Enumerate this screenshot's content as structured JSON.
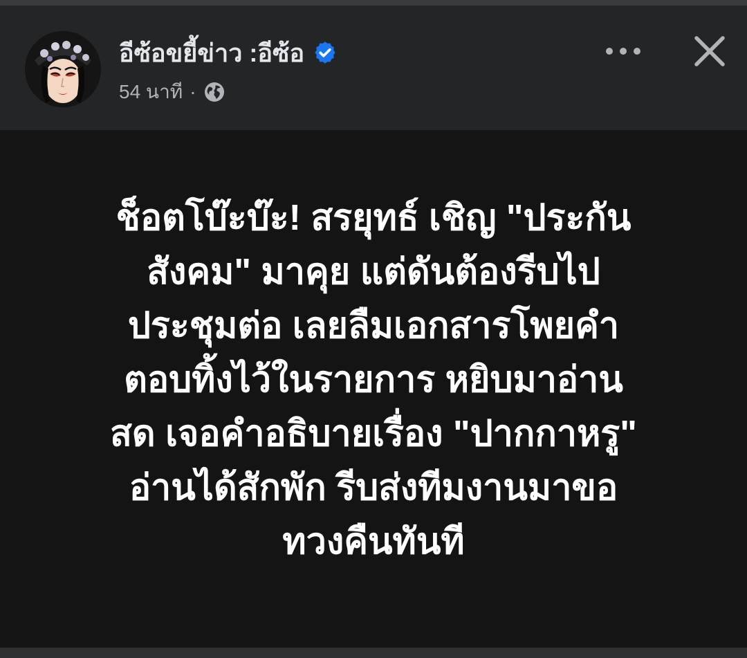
{
  "post": {
    "author": "อีซ้อขยี้ข่าว :อีซ้อ",
    "verified": true,
    "time": "54 นาที",
    "separator": "·",
    "privacy_icon": "globe-icon",
    "text_lines": [
      "ช็อตโบ๊ะบ๊ะ! สรยุทธ์ เชิญ \"ประกัน",
      "สังคม\" มาคุย แต่ดันต้องรีบไป",
      "ประชุมต่อ เลยลืมเอกสารโพยคำ",
      "ตอบทิ้งไว้ในรายการ หยิบมาอ่าน",
      "สด เจอคำอธิบายเรื่อง \"ปากกาหรู\"",
      "อ่านได้สักพัก รีบส่งทีมงานมาขอ",
      "ทวงคืนทันที"
    ]
  },
  "icons": {
    "more": "more-options-icon",
    "close": "close-icon",
    "verified": "verified-badge-icon",
    "avatar": "profile-avatar"
  },
  "colors": {
    "header_bg": "#242526",
    "body_bg": "#141414",
    "verified_blue": "#1877f2",
    "text_primary": "#e4e6eb",
    "text_secondary": "#b0b3b8"
  }
}
